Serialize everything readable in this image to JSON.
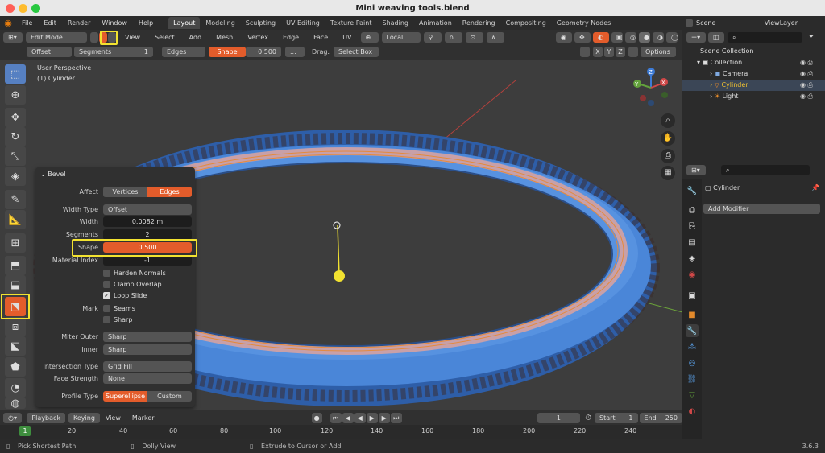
{
  "window": {
    "title": "Mini weaving tools.blend"
  },
  "menus": [
    "File",
    "Edit",
    "Render",
    "Window",
    "Help"
  ],
  "workspaces": [
    {
      "label": "Layout",
      "active": true
    },
    {
      "label": "Modeling"
    },
    {
      "label": "Sculpting"
    },
    {
      "label": "UV Editing"
    },
    {
      "label": "Texture Paint"
    },
    {
      "label": "Shading"
    },
    {
      "label": "Animation"
    },
    {
      "label": "Rendering"
    },
    {
      "label": "Compositing"
    },
    {
      "label": "Geometry Nodes"
    }
  ],
  "scene": {
    "label": "Scene",
    "view_layer": "ViewLayer"
  },
  "header": {
    "mode": "Edit Mode",
    "view": "View",
    "select": "Select",
    "add": "Add",
    "mesh": "Mesh",
    "vertex": "Vertex",
    "edge": "Edge",
    "face": "Face",
    "uv": "UV",
    "pivot": "Local"
  },
  "tool_header": {
    "offset": "Offset",
    "segments_label": "Segments",
    "segments_value": "1",
    "affect": "Edges",
    "shape_label": "Shape",
    "shape_value": "0.500",
    "more": "...",
    "drag_label": "Drag:",
    "drag_value": "Select Box",
    "axes": [
      "X",
      "Y",
      "Z"
    ],
    "options": "Options"
  },
  "viewport": {
    "perspective": "User Perspective",
    "object": "(1) Cylinder"
  },
  "gizmo": {
    "x": "X",
    "y": "Y",
    "z": "Z"
  },
  "bevel": {
    "title": "Bevel",
    "affect_label": "Affect",
    "affect_options": [
      "Vertices",
      "Edges"
    ],
    "width_type_label": "Width Type",
    "width_type": "Offset",
    "width_label": "Width",
    "width": "0.0082 m",
    "segments_label": "Segments",
    "segments": "2",
    "shape_label": "Shape",
    "shape": "0.500",
    "material_label": "Material Index",
    "material": "-1",
    "harden_normals": "Harden Normals",
    "clamp_overlap": "Clamp Overlap",
    "loop_slide": "Loop Slide",
    "mark_label": "Mark",
    "seams": "Seams",
    "sharp": "Sharp",
    "miter_outer_label": "Miter Outer",
    "miter_outer": "Sharp",
    "inner_label": "Inner",
    "inner": "Sharp",
    "intersection_label": "Intersection Type",
    "intersection": "Grid Fill",
    "face_strength_label": "Face Strength",
    "face_strength": "None",
    "profile_label": "Profile Type",
    "profile_options": [
      "Superellipse",
      "Custom"
    ]
  },
  "outliner": {
    "scene_collection": "Scene Collection",
    "collection": "Collection",
    "items": [
      "Camera",
      "Cylinder",
      "Light"
    ]
  },
  "properties": {
    "object": "Cylinder",
    "add_modifier": "Add Modifier"
  },
  "timeline": {
    "playback": "Playback",
    "keying": "Keying",
    "view": "View",
    "marker": "Marker",
    "current_frame": "1",
    "start_label": "Start",
    "start": "1",
    "end_label": "End",
    "end": "250",
    "ticks": [
      "1",
      "20",
      "40",
      "60",
      "80",
      "100",
      "120",
      "140",
      "160",
      "180",
      "200",
      "220",
      "240"
    ]
  },
  "status": {
    "left": "Pick Shortest Path",
    "middle": "Dolly View",
    "right": "Extrude to Cursor or Add",
    "version": "3.6.3"
  },
  "colors": {
    "accent": "#e35c2b",
    "select": "#f2e230",
    "mesh": "#4a86d8",
    "bg": "#3d3d3d"
  }
}
